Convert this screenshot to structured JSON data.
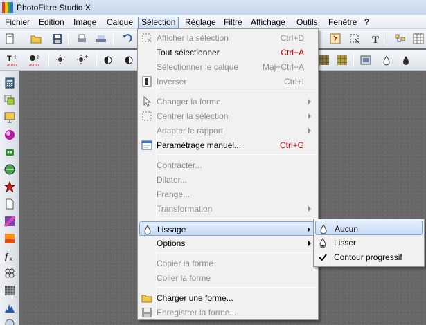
{
  "window": {
    "title": "PhotoFiltre Studio X"
  },
  "menubar": {
    "items": [
      {
        "label": "Fichier"
      },
      {
        "label": "Edition"
      },
      {
        "label": "Image"
      },
      {
        "label": "Calque"
      },
      {
        "label": "Sélection"
      },
      {
        "label": "Réglage"
      },
      {
        "label": "Filtre"
      },
      {
        "label": "Affichage"
      },
      {
        "label": "Outils"
      },
      {
        "label": "Fenêtre"
      },
      {
        "label": "?"
      }
    ],
    "active": "Sélection"
  },
  "selection_menu": {
    "items": [
      {
        "label": "Afficher la sélection",
        "shortcut": "Ctrl+D",
        "enabled": false,
        "icon": "show-selection-icon"
      },
      {
        "label": "Tout sélectionner",
        "shortcut": "Ctrl+A",
        "enabled": true
      },
      {
        "label": "Sélectionner le calque",
        "shortcut": "Maj+Ctrl+A",
        "enabled": false
      },
      {
        "label": "Inverser",
        "shortcut": "Ctrl+I",
        "enabled": false,
        "icon": "invert-icon"
      },
      {
        "label": "Changer la forme",
        "enabled": false,
        "submenu": true,
        "icon": "pointer-icon"
      },
      {
        "label": "Centrer la sélection",
        "enabled": false,
        "submenu": true,
        "icon": "center-selection-icon"
      },
      {
        "label": "Adapter le rapport",
        "enabled": false,
        "submenu": true
      },
      {
        "label": "Paramétrage manuel...",
        "shortcut": "Ctrl+G",
        "enabled": true,
        "icon": "manual-settings-icon"
      },
      {
        "label": "Contracter...",
        "enabled": false
      },
      {
        "label": "Dilater...",
        "enabled": false
      },
      {
        "label": "Frange...",
        "enabled": false
      },
      {
        "label": "Transformation",
        "enabled": false,
        "submenu": true
      },
      {
        "label": "Lissage",
        "enabled": true,
        "submenu": true,
        "highlighted": true,
        "icon": "drop-icon"
      },
      {
        "label": "Options",
        "enabled": true,
        "submenu": true
      },
      {
        "label": "Copier la forme",
        "enabled": false
      },
      {
        "label": "Coller la forme",
        "enabled": false
      },
      {
        "label": "Charger une forme...",
        "enabled": true,
        "icon": "open-folder-icon"
      },
      {
        "label": "Enregistrer la forme...",
        "enabled": false,
        "icon": "save-disk-icon"
      }
    ]
  },
  "lissage_submenu": {
    "items": [
      {
        "label": "Aucun",
        "highlighted": true,
        "icon": "drop-outline-icon"
      },
      {
        "label": "Lisser",
        "icon": "drop-filled-icon"
      },
      {
        "label": "Contour progressif",
        "checked": true
      }
    ]
  },
  "colors": {
    "accent_red": "#c00000",
    "highlight": "#c7dcf6",
    "disabled_text": "#8d8d8d",
    "workspace": "#676767"
  }
}
